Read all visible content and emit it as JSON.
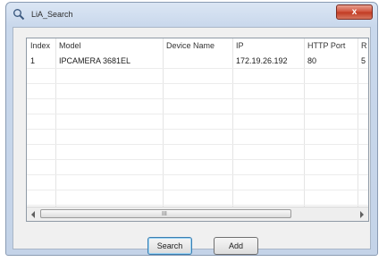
{
  "window": {
    "title": "LiA_Search",
    "close_label": "x"
  },
  "table": {
    "columns": [
      "Index",
      "Model",
      "Device Name",
      "IP",
      "HTTP Port",
      "R"
    ],
    "rows": [
      [
        "1",
        "IPCAMERA 3681EL",
        "",
        "172.19.26.192",
        "80",
        "5"
      ]
    ]
  },
  "scrollbar": {
    "grip_label": "III"
  },
  "buttons": {
    "search": "Search",
    "add": "Add"
  }
}
